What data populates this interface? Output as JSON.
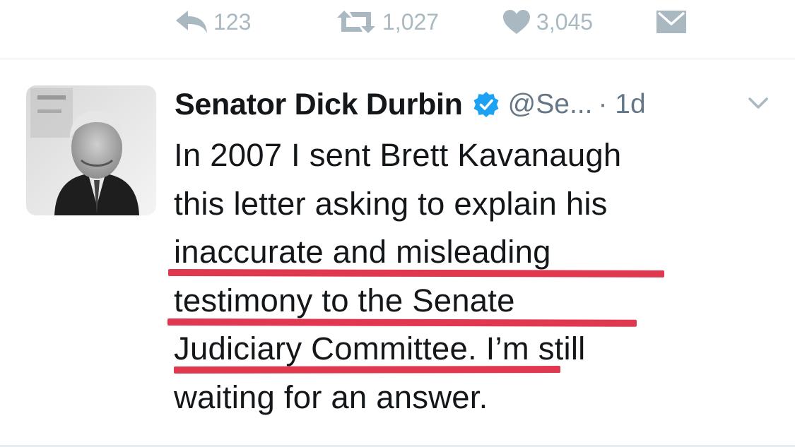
{
  "actions": {
    "reply": {
      "icon": "reply-icon",
      "count": "123"
    },
    "retweet": {
      "icon": "retweet-icon",
      "count": "1,027"
    },
    "like": {
      "icon": "heart-icon",
      "count": "3,045"
    },
    "dm": {
      "icon": "envelope-icon"
    }
  },
  "tweet": {
    "author_name": "Senator Dick Durbin",
    "verified": true,
    "handle": "@Se...",
    "time": "· 1d",
    "lines": [
      "In 2007 I sent Brett Kavanaugh",
      "this letter asking to explain his",
      "inaccurate and misleading",
      "testimony to the Senate",
      "Judiciary Committee. I’m still",
      "waiting for an answer."
    ],
    "highlight_color": "#e0394f"
  },
  "colors": {
    "action_gray": "#aab8c2",
    "verified_blue": "#1da1f2",
    "text": "#14171a",
    "secondary_text": "#657786"
  }
}
